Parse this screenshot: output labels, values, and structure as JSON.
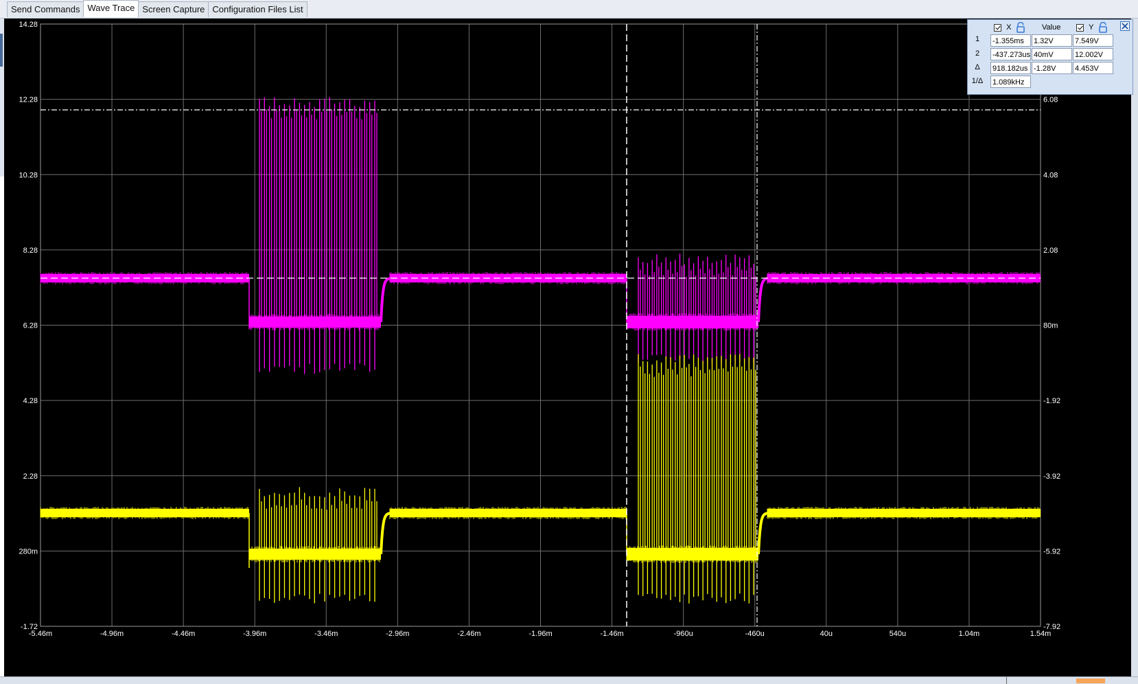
{
  "tabs": [
    {
      "label": "Send Commands",
      "active": false
    },
    {
      "label": "Wave Trace",
      "active": true
    },
    {
      "label": "Screen Capture",
      "active": false
    },
    {
      "label": "Configuration Files List",
      "active": false
    }
  ],
  "scope": {
    "left_axis": [
      "14.28",
      "12.28",
      "10.28",
      "8.28",
      "6.28",
      "4.28",
      "2.28",
      "280m",
      "-1.72"
    ],
    "right_axis": [
      "6.08",
      "4.08",
      "2.08",
      "80m",
      "-1.92",
      "-3.92",
      "-5.92",
      "-7.92"
    ],
    "x_axis": [
      "-5.46m",
      "-4.96m",
      "-4.46m",
      "-3.96m",
      "-3.46m",
      "-2.96m",
      "-2.46m",
      "-1.96m",
      "-1.46m",
      "-960u",
      "-460u",
      "40u",
      "540u",
      "1.04m",
      "1.54m"
    ],
    "colors": {
      "ch1": "#ff00ff",
      "ch2": "#ffff00",
      "grid": "#6e6e6e",
      "background": "#000000",
      "cursor": "#ffffff"
    }
  },
  "cursor_panel": {
    "header": {
      "x_label": "X",
      "value_label": "Value",
      "y_label": "Y"
    },
    "rows": [
      {
        "label": "1",
        "x": "-1.355ms",
        "value": "1.32V",
        "y": "7.549V"
      },
      {
        "label": "2",
        "x": "-437.273us",
        "value": "40mV",
        "y": "12.002V"
      },
      {
        "label": "Δ",
        "x": "918.182us",
        "value": "-1.28V",
        "y": "4.453V"
      },
      {
        "label": "1/Δ",
        "x": "1.089kHz",
        "value": "",
        "y": ""
      }
    ]
  }
}
